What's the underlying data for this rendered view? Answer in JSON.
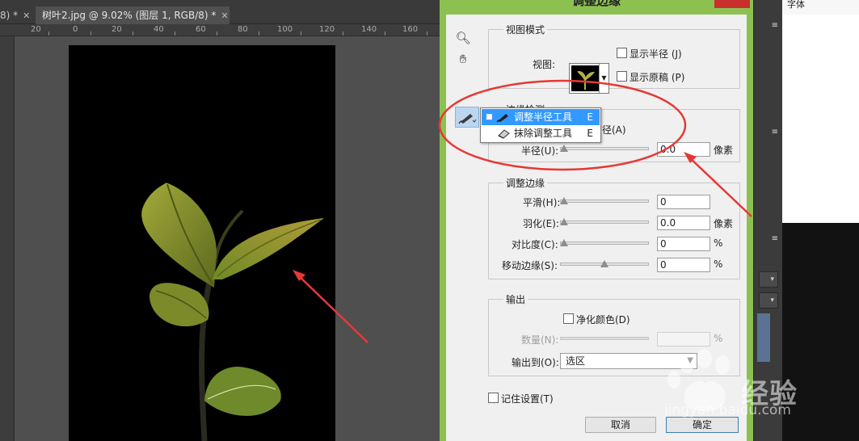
{
  "document": {
    "prev_tab": "8) *",
    "tab_title": "树叶2.jpg @ 9.02% (图层 1, RGB/8) *",
    "ruler_marks": [
      "20",
      "0",
      "20",
      "40",
      "60",
      "80",
      "100",
      "120",
      "140",
      "160"
    ]
  },
  "dialog": {
    "title": "调整边缘",
    "view_mode": {
      "legend": "视图模式",
      "view_label": "视图:",
      "show_radius": "显示半径 (J)",
      "show_original": "显示原稿 (P)"
    },
    "edge_detection": {
      "legend": "边缘检测",
      "smart_radius_suffix": "径(A)",
      "radius_label": "半径(U):",
      "radius_value": "0.0",
      "radius_unit": "像素"
    },
    "adjust_edge": {
      "legend": "调整边缘",
      "smooth_label": "平滑(H):",
      "smooth_value": "0",
      "feather_label": "羽化(E):",
      "feather_value": "0.0",
      "feather_unit": "像素",
      "contrast_label": "对比度(C):",
      "contrast_value": "0",
      "contrast_unit": "%",
      "shift_label": "移动边缘(S):",
      "shift_value": "0",
      "shift_unit": "%"
    },
    "output": {
      "legend": "输出",
      "decontaminate": "净化颜色(D)",
      "amount_label": "数量(N):",
      "amount_unit": "%",
      "output_to_label": "输出到(O):",
      "output_to_value": "选区"
    },
    "remember": "记住设置(T)",
    "cancel": "取消",
    "ok": "确定"
  },
  "tool_popup": {
    "items": [
      {
        "label": "调整半径工具",
        "key": "E"
      },
      {
        "label": "抹除调整工具",
        "key": "E"
      }
    ]
  },
  "right_panel": {
    "font_tab": "字体"
  },
  "watermark": {
    "brand": "Bai",
    "brand2": "经验",
    "url": "jingyan.baidu.com"
  },
  "colors": {
    "dialog_frame": "#8cc152",
    "annotation": "#e53935",
    "selection": "#3399ff"
  }
}
